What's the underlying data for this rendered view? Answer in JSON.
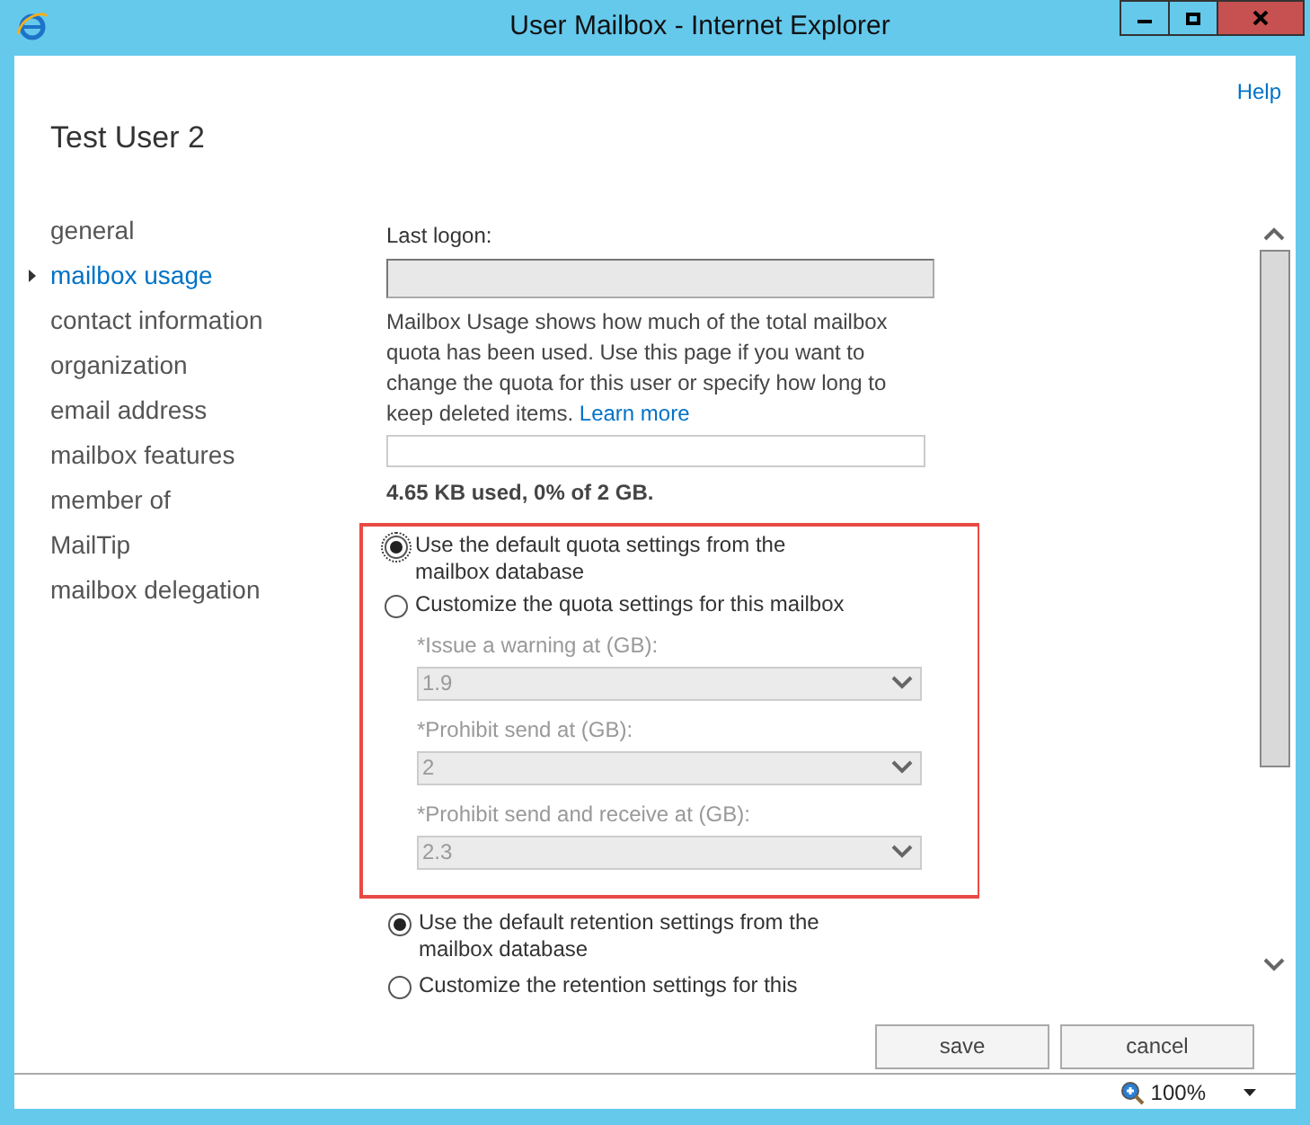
{
  "window": {
    "title": "User Mailbox - Internet Explorer"
  },
  "help": "Help",
  "heading": "Test User 2",
  "nav": [
    {
      "label": "general",
      "selected": false
    },
    {
      "label": "mailbox usage",
      "selected": true
    },
    {
      "label": "contact information",
      "selected": false
    },
    {
      "label": "organization",
      "selected": false
    },
    {
      "label": "email address",
      "selected": false
    },
    {
      "label": "mailbox features",
      "selected": false
    },
    {
      "label": "member of",
      "selected": false
    },
    {
      "label": "MailTip",
      "selected": false
    },
    {
      "label": "mailbox delegation",
      "selected": false
    }
  ],
  "last_logon": {
    "label": "Last logon:",
    "disabled": true
  },
  "description": {
    "text": "Mailbox Usage shows how much of the total mailbox quota has been used. Use this page if you want to change the quota for this user or specify how long to keep deleted items.",
    "link": "Learn more"
  },
  "usage": {
    "text": "4.65 KB used, 0% of 2 GB."
  },
  "quota_options": [
    {
      "label": "Use the default quota settings from the mailbox database",
      "selected": true,
      "focused": true
    },
    {
      "label": "Customize the quota settings for this mailbox",
      "selected": false,
      "focused": false
    }
  ],
  "quota_fields": [
    {
      "label": "*Issue a warning at (GB):",
      "value": "1.9",
      "disabled": true
    },
    {
      "label": "*Prohibit send at (GB):",
      "value": "2",
      "disabled": true
    },
    {
      "label": "*Prohibit send and receive at (GB):",
      "value": "2.3",
      "disabled": true
    }
  ],
  "retention_options": [
    {
      "label": "Use the default retention settings from the mailbox database",
      "selected": true,
      "focused": false
    },
    {
      "label": "Customize the retention settings for this",
      "selected": false,
      "focused": false
    }
  ],
  "buttons": [
    "save",
    "cancel"
  ],
  "status_bar": {
    "zoom": "100%"
  }
}
